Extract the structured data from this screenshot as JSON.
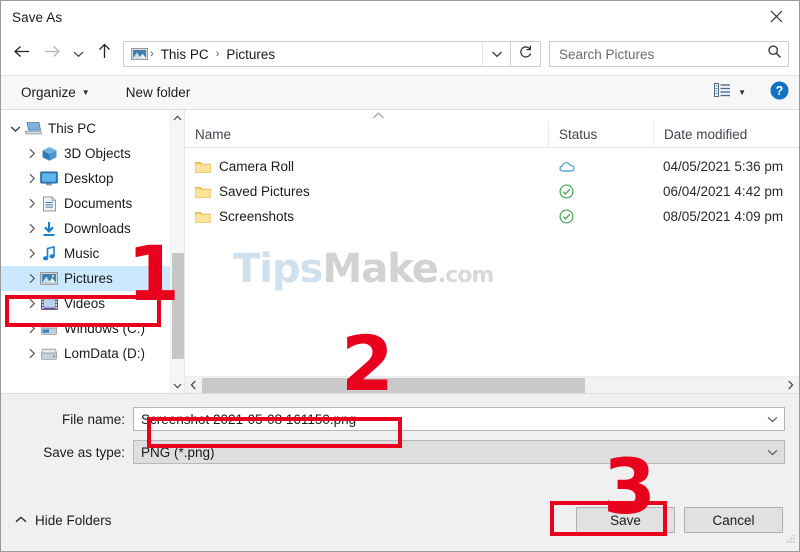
{
  "window": {
    "title": "Save As",
    "close_icon": "close-icon"
  },
  "navbar": {
    "back_icon": "arrow-left-icon",
    "forward_icon": "arrow-right-icon",
    "recent_icon": "chevron-down-icon",
    "up_icon": "arrow-up-icon",
    "location_icon": "pictures-folder-icon",
    "breadcrumbs": [
      "This PC",
      "Pictures"
    ],
    "separator": "›",
    "dropdown_icon": "chevron-down-icon",
    "refresh_icon": "refresh-icon",
    "search_placeholder": "Search Pictures",
    "search_value": "",
    "search_icon": "magnifier-icon"
  },
  "commandbar": {
    "organize_label": "Organize",
    "organize_caret_icon": "caret-down-icon",
    "new_folder_label": "New folder",
    "view_icon": "view-layout-icon",
    "view_caret_icon": "caret-down-icon",
    "help_icon": "help-question-icon",
    "help_label": "?"
  },
  "sidebar": {
    "items": [
      {
        "label": "This PC",
        "icon": "this-pc-icon",
        "level": 0,
        "expander": "chevron-down-icon",
        "selected": false
      },
      {
        "label": "3D Objects",
        "icon": "3d-objects-icon",
        "level": 1,
        "expander": "chevron-right-icon",
        "selected": false
      },
      {
        "label": "Desktop",
        "icon": "desktop-icon",
        "level": 1,
        "expander": "chevron-right-icon",
        "selected": false
      },
      {
        "label": "Documents",
        "icon": "documents-icon",
        "level": 1,
        "expander": "chevron-right-icon",
        "selected": false
      },
      {
        "label": "Downloads",
        "icon": "downloads-icon",
        "level": 1,
        "expander": "chevron-right-icon",
        "selected": false
      },
      {
        "label": "Music",
        "icon": "music-icon",
        "level": 1,
        "expander": "chevron-right-icon",
        "selected": false
      },
      {
        "label": "Pictures",
        "icon": "pictures-icon",
        "level": 1,
        "expander": "chevron-right-icon",
        "selected": true
      },
      {
        "label": "Videos",
        "icon": "videos-icon",
        "level": 1,
        "expander": "chevron-right-icon",
        "selected": false
      },
      {
        "label": "Windows (C:)",
        "icon": "system-drive-icon",
        "level": 1,
        "expander": "chevron-right-icon",
        "selected": false
      },
      {
        "label": "LomData (D:)",
        "icon": "drive-icon",
        "level": 1,
        "expander": "chevron-right-icon",
        "selected": false
      }
    ],
    "scroll_up_icon": "chevron-up-icon",
    "scroll_down_icon": "chevron-down-icon"
  },
  "filelist": {
    "sort_indicator_icon": "sort-ascending-icon",
    "columns": [
      "Name",
      "Status",
      "Date modified"
    ],
    "rows": [
      {
        "name": "Camera Roll",
        "icon": "folder-icon",
        "status_icon": "cloud-icon",
        "date": "04/05/2021 5:36 pm"
      },
      {
        "name": "Saved Pictures",
        "icon": "folder-icon",
        "status_icon": "check-circle-icon",
        "date": "06/04/2021 4:42 pm"
      },
      {
        "name": "Screenshots",
        "icon": "folder-icon",
        "status_icon": "check-circle-icon",
        "date": "08/05/2021 4:09 pm"
      }
    ],
    "scroll_left_icon": "chevron-left-icon",
    "scroll_right_icon": "chevron-right-icon"
  },
  "watermark": {
    "part1": "Tips",
    "part2": "Make",
    "part3": ".com",
    "color1": "#cfe0ee",
    "color2": "#d2d2d2"
  },
  "form": {
    "filename_label": "File name:",
    "filename_value": "Screenshot 2021-05-08 161150.png",
    "filename_dropdown_icon": "chevron-down-icon",
    "filetype_label": "Save as type:",
    "filetype_value": "PNG (*.png)",
    "filetype_dropdown_icon": "chevron-down-icon"
  },
  "footer": {
    "hide_folders_label": "Hide Folders",
    "hide_folders_icon": "chevron-up-icon",
    "save_label": "Save",
    "cancel_label": "Cancel",
    "resize_grip_icon": "resize-grip-icon"
  },
  "annotations": {
    "accent_color": "#e8001d",
    "step1": "1",
    "step2": "2",
    "step3": "3"
  }
}
